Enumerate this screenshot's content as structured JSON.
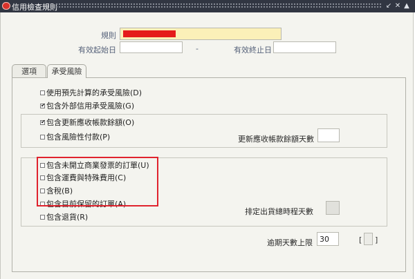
{
  "window": {
    "title": "信用檢查規則",
    "controls": [
      "↙",
      "✕",
      "▲"
    ]
  },
  "header": {
    "rule_label": "規則",
    "rule_value": "",
    "start_date_label": "有效起始日",
    "start_date_value": "",
    "separator": "-",
    "end_date_label": "有效終止日",
    "end_date_value": ""
  },
  "tabs": [
    {
      "label": "選項",
      "active": false
    },
    {
      "label": "承受風險",
      "active": true
    }
  ],
  "group1": {
    "items": [
      {
        "label": "使用預先計算的承受風險(D)",
        "checked": false
      },
      {
        "label": "包含外部信用承受風險(G)",
        "checked": true
      }
    ]
  },
  "group2": {
    "items": [
      {
        "label": "包含更新應收帳款餘額(O)",
        "checked": true
      },
      {
        "label": "包含風險性付款(P)",
        "checked": false
      }
    ],
    "days_label": "更新應收帳款餘額天數",
    "days_value": ""
  },
  "group3": {
    "items": [
      {
        "label": "包含未開立商業發票的訂單(U)",
        "checked": false
      },
      {
        "label": "包含運費與特殊費用(C)",
        "checked": false
      },
      {
        "label": "含稅(B)",
        "checked": false
      },
      {
        "label": "包含目前保留的訂單(A)",
        "checked": false
      },
      {
        "label": "包含退貨(R)",
        "checked": false
      }
    ],
    "shipping_label": "排定出貨總時程天數",
    "shipping_value": ""
  },
  "overdue": {
    "label": "逾期天數上限",
    "value": "30",
    "bracket_left": "[",
    "bracket_right": "]"
  },
  "colors": {
    "titlebar": "#313642",
    "window_bg": "#f4f4ef",
    "required_field": "#fbf0b8",
    "highlight_box": "#e0222d",
    "label_text": "#56627a"
  }
}
